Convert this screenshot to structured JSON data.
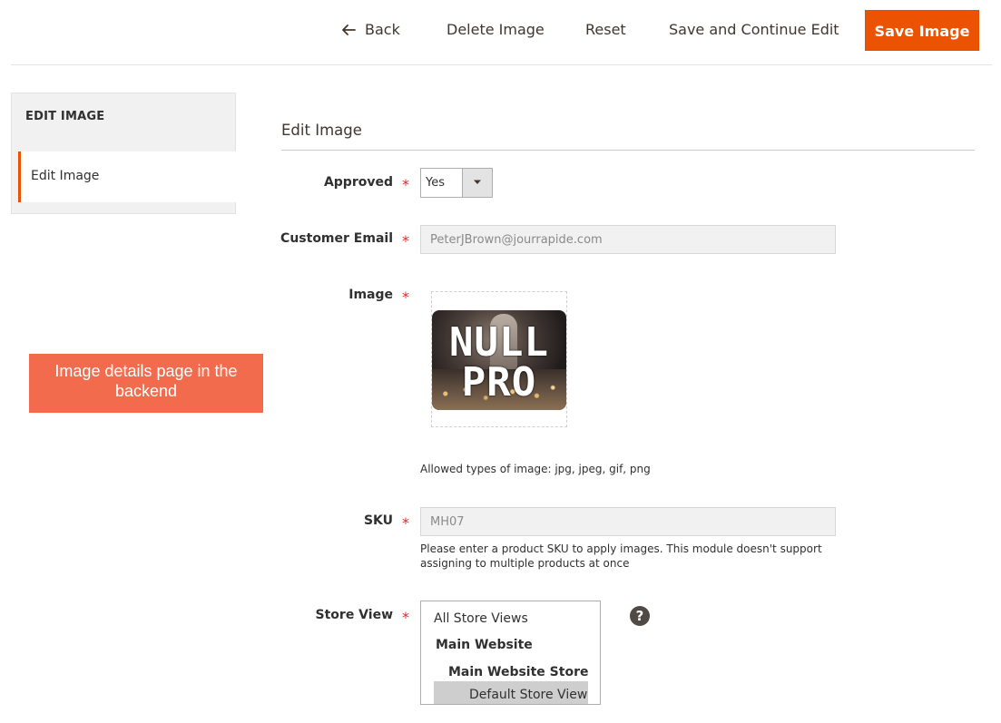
{
  "toolbar": {
    "back_label": "Back",
    "delete_label": "Delete Image",
    "reset_label": "Reset",
    "save_continue_label": "Save and Continue Edit",
    "save_label": "Save Image"
  },
  "sidebar": {
    "title": "EDIT IMAGE",
    "items": [
      {
        "label": "Edit Image",
        "active": true
      }
    ]
  },
  "callout": {
    "text": "Image details page in the backend"
  },
  "form": {
    "section_title": "Edit Image",
    "approved": {
      "label": "Approved",
      "required_mark": "*",
      "value": "Yes"
    },
    "customer_email": {
      "label": "Customer Email",
      "required_mark": "*",
      "value": "PeterJBrown@jourrapide.com"
    },
    "image": {
      "label": "Image",
      "required_mark": "*",
      "watermark_line1": "NULL",
      "watermark_line2": "PRO",
      "note": "Allowed types of image: jpg, jpeg, gif, png"
    },
    "sku": {
      "label": "SKU",
      "required_mark": "*",
      "value": "MH07",
      "note_line1": "Please enter a product SKU to apply images. This module doesn't support",
      "note_line2": "assigning to multiple products at once"
    },
    "store_view": {
      "label": "Store View",
      "required_mark": "*",
      "options": {
        "all": "All Store Views",
        "website": "Main Website",
        "store": "Main Website Store",
        "view": "Default Store View"
      },
      "selected": "Default Store View",
      "help_glyph": "?"
    }
  },
  "colors": {
    "accent": "#eb5202",
    "callout": "#f26b4c",
    "required": "#e22626",
    "selected_option": "#cecece"
  }
}
